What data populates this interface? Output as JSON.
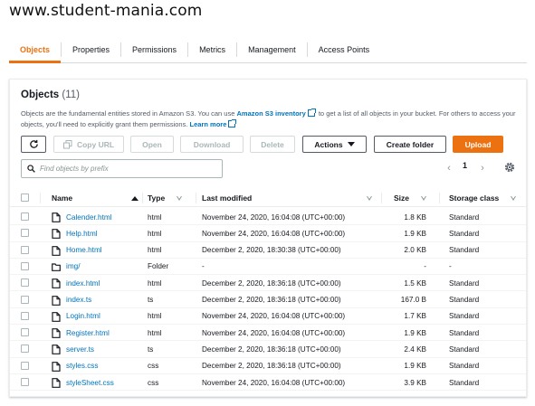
{
  "site": {
    "title": "www.student-mania.com"
  },
  "tabs": [
    {
      "label": "Objects",
      "active": true
    },
    {
      "label": "Properties",
      "active": false
    },
    {
      "label": "Permissions",
      "active": false
    },
    {
      "label": "Metrics",
      "active": false
    },
    {
      "label": "Management",
      "active": false
    },
    {
      "label": "Access Points",
      "active": false
    }
  ],
  "objects_panel": {
    "title": "Objects",
    "count": "(11)",
    "desc_part1": "Objects are the fundamental entities stored in Amazon S3. You can use ",
    "desc_link1": "Amazon S3 inventory",
    "desc_part2": " to get a list of all objects in your bucket. For others to access your objects, you'll need to explicitly grant them permissions. ",
    "desc_link2": "Learn more"
  },
  "toolbar": {
    "refresh_icon": "refresh-icon",
    "copy_url": "Copy URL",
    "open": "Open",
    "download": "Download",
    "delete": "Delete",
    "actions": "Actions",
    "create_folder": "Create folder",
    "upload": "Upload"
  },
  "search": {
    "placeholder": "Find objects by prefix",
    "icon": "search-icon"
  },
  "pagination": {
    "page": "1"
  },
  "colors": {
    "accent": "#ec7211",
    "link": "#0073bb",
    "text": "#16191f",
    "muted": "#545b64"
  },
  "table": {
    "headers": {
      "name": "Name",
      "type": "Type",
      "last_modified": "Last modified",
      "size": "Size",
      "storage_class": "Storage class"
    },
    "rows": [
      {
        "name": "Calender.html",
        "kind": "file",
        "type": "html",
        "modified": "November 24, 2020, 16:04:08 (UTC+00:00)",
        "size": "1.8 KB",
        "storage": "Standard"
      },
      {
        "name": "Help.html",
        "kind": "file",
        "type": "html",
        "modified": "November 24, 2020, 16:04:08 (UTC+00:00)",
        "size": "1.9 KB",
        "storage": "Standard"
      },
      {
        "name": "Home.html",
        "kind": "file",
        "type": "html",
        "modified": "December 2, 2020, 18:30:38 (UTC+00:00)",
        "size": "2.0 KB",
        "storage": "Standard"
      },
      {
        "name": "img/",
        "kind": "folder",
        "type": "Folder",
        "modified": "-",
        "size": "-",
        "storage": "-"
      },
      {
        "name": "index.html",
        "kind": "file",
        "type": "html",
        "modified": "December 2, 2020, 18:36:18 (UTC+00:00)",
        "size": "1.5 KB",
        "storage": "Standard"
      },
      {
        "name": "index.ts",
        "kind": "file",
        "type": "ts",
        "modified": "December 2, 2020, 18:36:18 (UTC+00:00)",
        "size": "167.0 B",
        "storage": "Standard"
      },
      {
        "name": "Login.html",
        "kind": "file",
        "type": "html",
        "modified": "November 24, 2020, 16:04:08 (UTC+00:00)",
        "size": "1.7 KB",
        "storage": "Standard"
      },
      {
        "name": "Register.html",
        "kind": "file",
        "type": "html",
        "modified": "November 24, 2020, 16:04:08 (UTC+00:00)",
        "size": "1.9 KB",
        "storage": "Standard"
      },
      {
        "name": "server.ts",
        "kind": "file",
        "type": "ts",
        "modified": "December 2, 2020, 18:36:18 (UTC+00:00)",
        "size": "2.4 KB",
        "storage": "Standard"
      },
      {
        "name": "styles.css",
        "kind": "file",
        "type": "css",
        "modified": "December 2, 2020, 18:36:18 (UTC+00:00)",
        "size": "1.9 KB",
        "storage": "Standard"
      },
      {
        "name": "styleSheet.css",
        "kind": "file",
        "type": "css",
        "modified": "November 24, 2020, 16:04:08 (UTC+00:00)",
        "size": "3.9 KB",
        "storage": "Standard"
      }
    ]
  }
}
